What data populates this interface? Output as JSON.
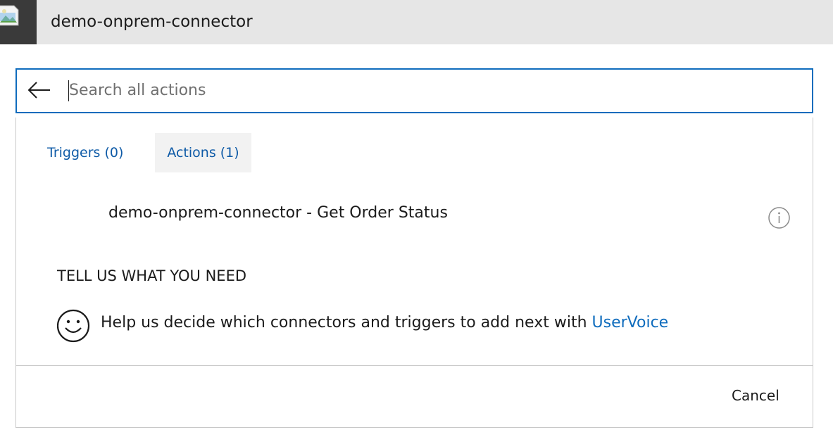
{
  "header": {
    "title": "demo-onprem-connector",
    "icon": "broken-image-icon"
  },
  "search": {
    "placeholder": "Search all actions",
    "value": "",
    "back_icon": "arrow-left-icon",
    "border_color": "#0f6cbd"
  },
  "tabs": [
    {
      "label": "Triggers (0)",
      "selected": false
    },
    {
      "label": "Actions (1)",
      "selected": true
    }
  ],
  "actions": [
    {
      "label": "demo-onprem-connector - Get Order Status",
      "info_icon": "info-icon"
    }
  ],
  "feedback": {
    "heading": "TELL US WHAT YOU NEED",
    "icon": "smiley-icon",
    "text": "Help us decide which connectors and triggers to add next with ",
    "link_label": "UserVoice"
  },
  "footer": {
    "cancel_label": "Cancel"
  },
  "colors": {
    "accent": "#0f6cbd",
    "header_bg": "#e6e6e6",
    "selected_tab_bg": "#f2f2f2"
  }
}
